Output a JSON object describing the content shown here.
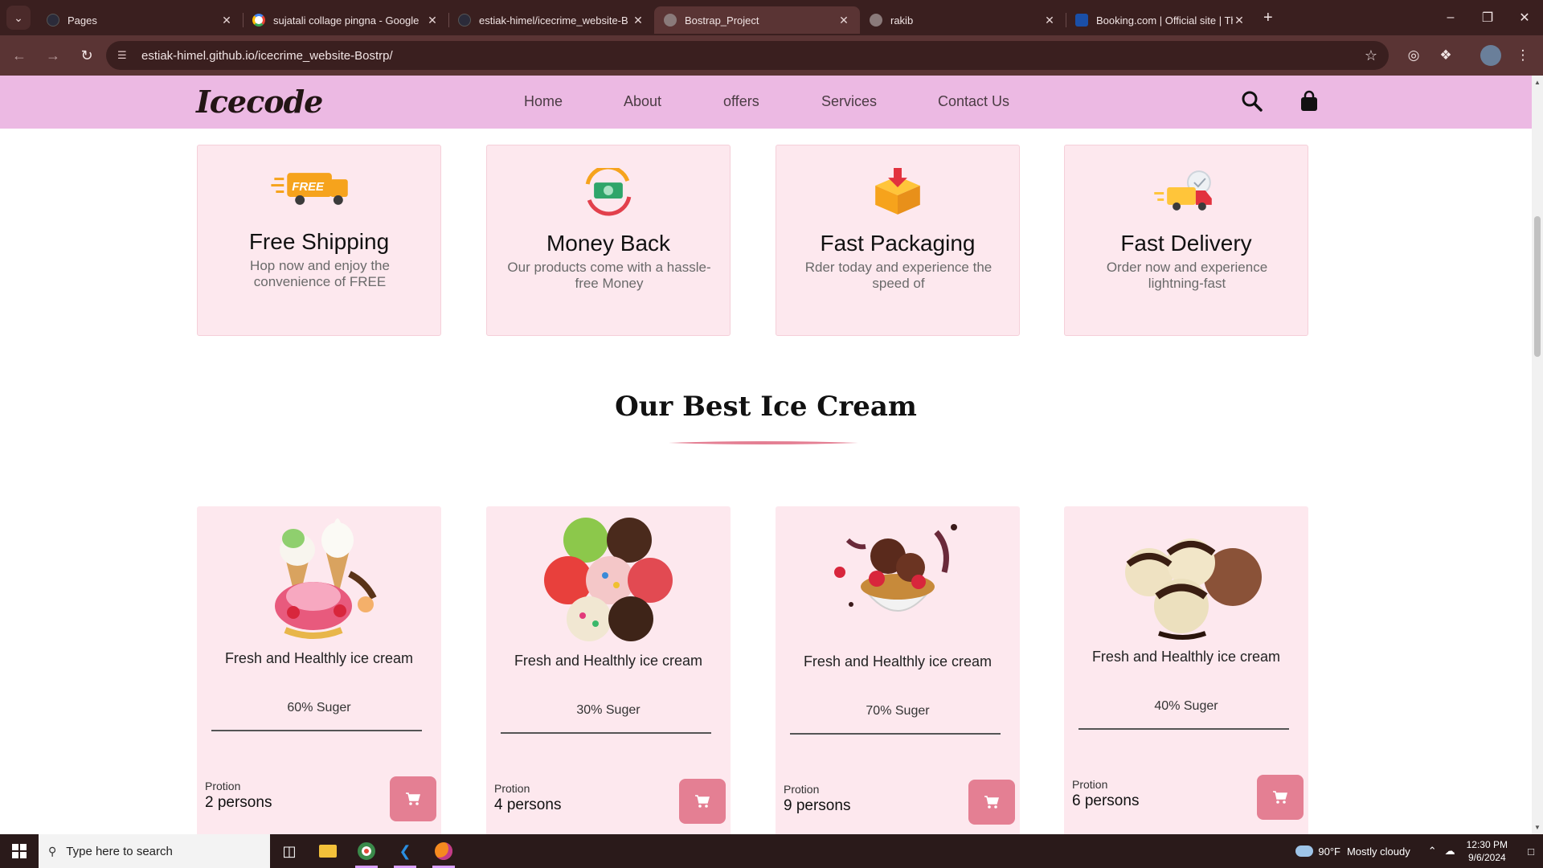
{
  "browser": {
    "tabs": [
      {
        "title": "Pages",
        "active": false,
        "favicon_color": "#2b2b3a"
      },
      {
        "title": "sujatali collage pingna - Google",
        "active": false,
        "favicon_color": "#ffffff"
      },
      {
        "title": "estiak-himel/icecrime_website-B",
        "active": false,
        "favicon_color": "#2b2b3a"
      },
      {
        "title": "Bostrap_Project",
        "active": true,
        "favicon_color": "#8a7a7a"
      },
      {
        "title": "rakib",
        "active": false,
        "favicon_color": "#8a7a7a"
      },
      {
        "title": "Booking.com | Official site | The",
        "active": false,
        "favicon_color": "#1a4fa8"
      }
    ],
    "url": "estiak-himel.github.io/icecrime_website-Bostrp/"
  },
  "site": {
    "logo": "Icecode",
    "nav": [
      "Home",
      "About",
      "offers",
      "Services",
      "Contact Us"
    ],
    "colors": {
      "nav_bg": "#ecb9e3",
      "card_bg": "#fde8ee",
      "accent": "#e47f93"
    },
    "features": [
      {
        "title": "Free Shipping",
        "text": "Hop now and enjoy the convenience of FREE",
        "icon": "free-shipping-truck-icon"
      },
      {
        "title": "Money Back",
        "text": "Our products come with a hassle-free Money",
        "icon": "money-back-icon"
      },
      {
        "title": "Fast Packaging",
        "text": "Rder today and experience the speed of",
        "icon": "package-box-icon"
      },
      {
        "title": "Fast Delivery",
        "text": "Order now and experience lightning-fast",
        "icon": "delivery-truck-icon"
      }
    ],
    "section_title": "Our Best Ice Cream",
    "products": [
      {
        "name": "Fresh and Healthly ice cream",
        "sugar": "60% Suger",
        "portion_label": "Protion",
        "portion": "2 persons",
        "image": "ice-cream-cones-image"
      },
      {
        "name": "Fresh and Healthly ice cream",
        "sugar": "30% Suger",
        "portion_label": "Protion",
        "portion": "4 persons",
        "image": "ice-cream-scoops-image"
      },
      {
        "name": "Fresh and Healthly ice cream",
        "sugar": "70% Suger",
        "portion_label": "Protion",
        "portion": "9 persons",
        "image": "ice-cream-bowl-image"
      },
      {
        "name": "Fresh and Healthly ice cream",
        "sugar": "40% Suger",
        "portion_label": "Protion",
        "portion": "6 persons",
        "image": "chocolate-vanilla-scoops-image"
      }
    ]
  },
  "taskbar": {
    "search_placeholder": "Type here to search",
    "weather_temp": "90°F",
    "weather_text": "Mostly cloudy",
    "time": "12:30 PM",
    "date": "9/6/2024"
  }
}
